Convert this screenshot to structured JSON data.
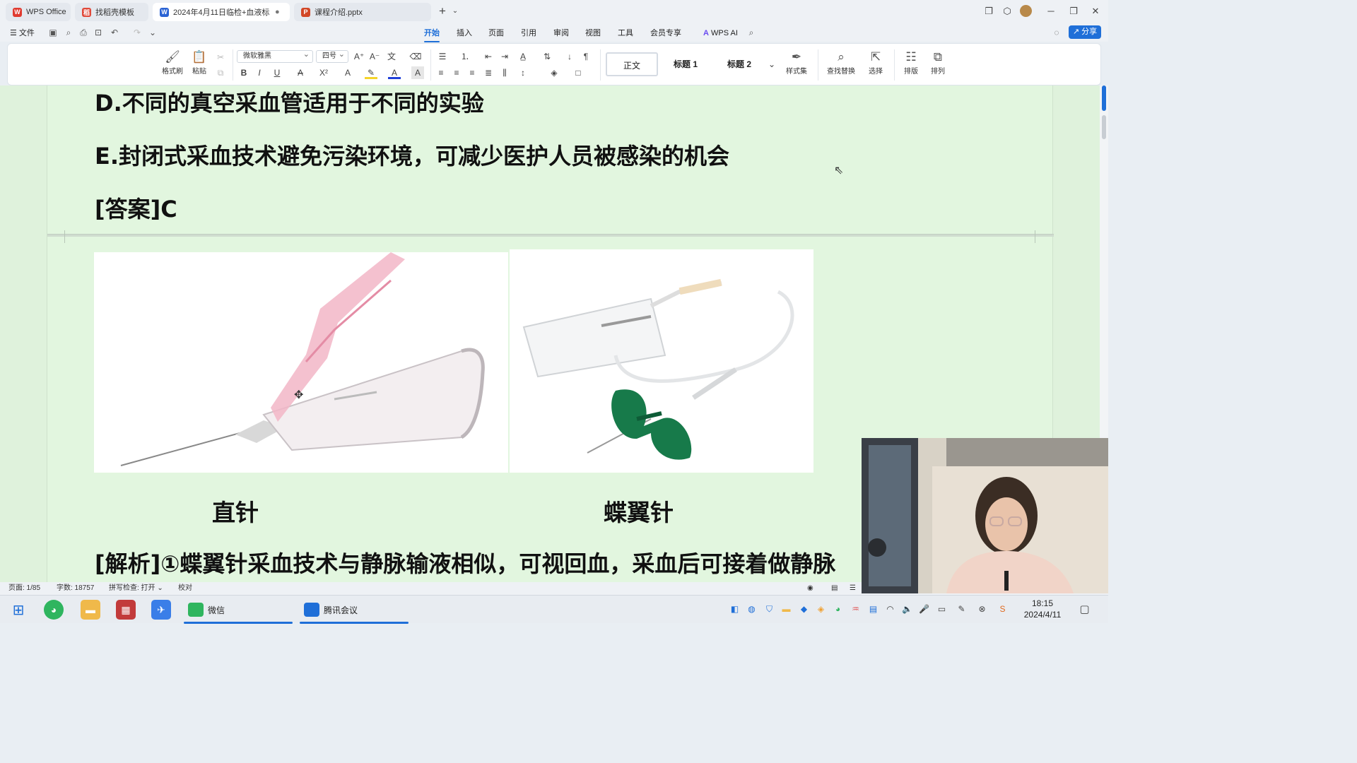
{
  "titlebar": {
    "tabs": [
      {
        "label": "WPS Office",
        "icon": "wps-logo-icon",
        "color": "#e03a2f"
      },
      {
        "label": "找稻壳模板",
        "icon": "docer-template-icon",
        "color": "#e0493a"
      },
      {
        "label": "2024年4月11日临检+血液标...",
        "icon": "word-doc-icon",
        "color": "#2a63d4",
        "active": true
      },
      {
        "label": "课程介绍.pptx",
        "icon": "ppt-doc-icon",
        "color": "#d24726"
      }
    ],
    "new_tab": "+"
  },
  "menubar": {
    "file": "文件",
    "tabs": [
      "开始",
      "插入",
      "页面",
      "引用",
      "审阅",
      "视图",
      "工具",
      "会员专享"
    ],
    "active_tab": "开始",
    "wps_ai": "WPS AI",
    "share": "分享"
  },
  "ribbon": {
    "format_painter": "格式刷",
    "paste": "粘贴",
    "font_name": "微软雅黑",
    "font_size": "四号",
    "styles": [
      "正文",
      "标题 1",
      "标题 2"
    ],
    "style_set": "样式集",
    "find_replace": "查找替换",
    "select": "选择",
    "layout": "排版",
    "arrange": "排列"
  },
  "document": {
    "line_d": "D.不同的真空采血管适用于不同的实验",
    "line_e": "E.封闭式采血技术避免污染环境，可减少医护人员被感染的机会",
    "answer": "[答案]C",
    "caption_left": "直针",
    "caption_right": "蝶翼针",
    "analysis": "[解析]①蝶翼针采血技术与静脉输液相似，可视回血，采血后可接着做静脉"
  },
  "statusbar": {
    "page": "页面: 1/85",
    "word_count": "字数: 18757",
    "spell_check": "拼写检查: 打开",
    "proofread": "校对"
  },
  "taskbar": {
    "wechat_label": "微信",
    "meeting_label": "腾讯会议",
    "time": "18:15",
    "date": "2024/4/11"
  },
  "colors": {
    "accent": "#1f6fd8",
    "doc_background": "#e2f6df"
  }
}
